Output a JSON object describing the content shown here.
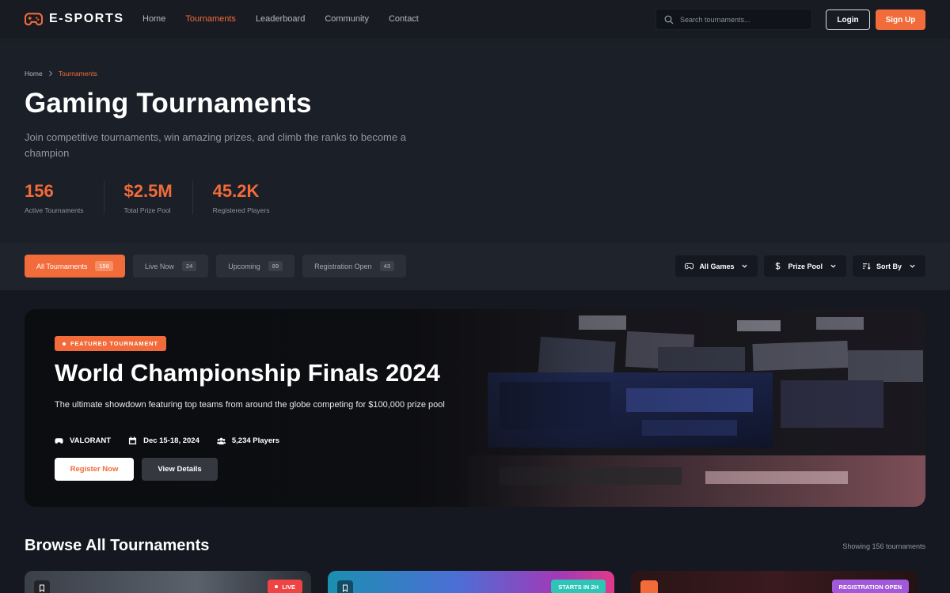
{
  "brand": {
    "name": "E-SPORTS",
    "accent": "#f26b3a"
  },
  "nav": {
    "items": [
      {
        "label": "Home",
        "active": false
      },
      {
        "label": "Tournaments",
        "active": true
      },
      {
        "label": "Leaderboard",
        "active": false
      },
      {
        "label": "Community",
        "active": false
      },
      {
        "label": "Contact",
        "active": false
      }
    ],
    "search_placeholder": "Search tournaments...",
    "login_label": "Login",
    "signup_label": "Sign Up"
  },
  "breadcrumb": {
    "home": "Home",
    "current": "Tournaments"
  },
  "hero": {
    "title": "Gaming Tournaments",
    "subtitle": "Join competitive tournaments, win amazing prizes, and climb the ranks to become a champion",
    "stats": [
      {
        "value": "156",
        "label": "Active Tournaments"
      },
      {
        "value": "$2.5M",
        "label": "Total Prize Pool"
      },
      {
        "value": "45.2K",
        "label": "Registered Players"
      }
    ]
  },
  "filters": {
    "tabs": [
      {
        "label": "All Tournaments",
        "count": "156",
        "active": true
      },
      {
        "label": "Live Now",
        "count": "24",
        "active": false
      },
      {
        "label": "Upcoming",
        "count": "89",
        "active": false
      },
      {
        "label": "Registration Open",
        "count": "43",
        "active": false
      }
    ],
    "dropdowns": [
      {
        "label": "All Games",
        "icon": "gamepad-icon"
      },
      {
        "label": "Prize Pool",
        "icon": "dollar-icon"
      },
      {
        "label": "Sort By",
        "icon": "sort-icon"
      }
    ]
  },
  "featured": {
    "badge": "FEATURED TOURNAMENT",
    "title": "World Championship Finals 2024",
    "description": "The ultimate showdown featuring top teams from around the globe competing for $100,000 prize pool",
    "game": "VALORANT",
    "dates": "Dec 15-18, 2024",
    "players": "5,234 Players",
    "register_label": "Register Now",
    "details_label": "View Details"
  },
  "browse": {
    "title": "Browse All Tournaments",
    "showing": "Showing 156 tournaments",
    "cards": [
      {
        "status": "LIVE",
        "status_color": "#ef4444"
      },
      {
        "status": "STARTS IN 2H",
        "status_color": "#2ec4b6"
      },
      {
        "status": "REGISTRATION OPEN",
        "status_color": "#a259d9"
      }
    ]
  }
}
